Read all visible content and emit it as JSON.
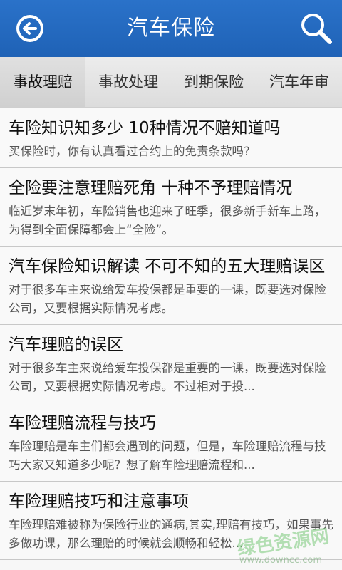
{
  "header": {
    "title": "汽车保险",
    "back_icon": "back-arrow-icon",
    "search_icon": "search-icon",
    "bar_color": "#2268bd"
  },
  "tabs": [
    {
      "label": "事故理赔",
      "active": true
    },
    {
      "label": "事故处理",
      "active": false
    },
    {
      "label": "到期保险",
      "active": false
    },
    {
      "label": "汽车年审",
      "active": false
    }
  ],
  "articles": [
    {
      "title": "车险知识知多少 10种情况不赔知道吗",
      "summary": "买保险时，你有认真看过合约上的免责条款吗?"
    },
    {
      "title": "全险要注意理赔死角 十种不予理赔情况",
      "summary": "临近岁末年初，车险销售也迎来了旺季，很多新手新车上路，为得到全面保障都会上“全险”。"
    },
    {
      "title": "汽车保险知识解读 不可不知的五大理赔误区",
      "summary": "对于很多车主来说给爱车投保都是重要的一课，既要选对保险公司，又要根据实际情况考虑。"
    },
    {
      "title": "汽车理赔的误区",
      "summary": "对于很多车主来说给爱车投保都是重要的一课，既要选对保险公司，又要根据实际情况考虑。不过相对于投..."
    },
    {
      "title": "车险理赔流程与技巧",
      "summary": "车险理赔是车主们都会遇到的问题，但是，车险理赔流程与技巧大家又知道多少呢？想了解车险理赔流程和..."
    },
    {
      "title": "车险理赔技巧和注意事项",
      "summary": "车险理赔难被称为保险行业的通病,其实,理赔有技巧，如果事先多做功课，那么理赔的时候就会顺畅和轻松..."
    }
  ],
  "watermark": {
    "text": "绿色资源网",
    "sub": "www.downcc.com"
  }
}
